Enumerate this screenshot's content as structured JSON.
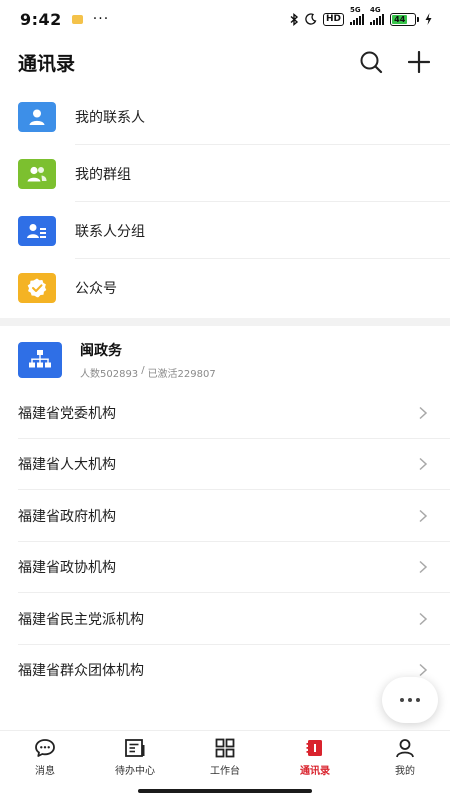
{
  "status_bar": {
    "time": "9:42",
    "more": "···",
    "hd": "HD",
    "net_1": "5G",
    "net_2": "4G",
    "battery": "44"
  },
  "header": {
    "title": "通讯录"
  },
  "menu": [
    {
      "label": "我的联系人",
      "icon": "contact-icon",
      "color": "#3d8fe8"
    },
    {
      "label": "我的群组",
      "icon": "group-icon",
      "color": "#7cc02f"
    },
    {
      "label": "联系人分组",
      "icon": "contact-group-icon",
      "color": "#2f6fe6"
    },
    {
      "label": "公众号",
      "icon": "official-account-icon",
      "color": "#f4b324"
    }
  ],
  "org": {
    "title": "闽政务",
    "people": "人数502893",
    "separator": "/",
    "activated": "已激活229807",
    "icon": "org-chart-icon",
    "color": "#2f6fe6",
    "items": [
      "福建省党委机构",
      "福建省人大机构",
      "福建省政府机构",
      "福建省政协机构",
      "福建省民主党派机构",
      "福建省群众团体机构"
    ]
  },
  "nav": [
    {
      "label": "消息",
      "icon": "message-icon"
    },
    {
      "label": "待办中心",
      "icon": "todo-icon"
    },
    {
      "label": "工作台",
      "icon": "workbench-icon"
    },
    {
      "label": "通讯录",
      "icon": "contacts-book-icon",
      "active": true
    },
    {
      "label": "我的",
      "icon": "profile-icon"
    }
  ],
  "colors": {
    "accent": "#d9232d"
  }
}
